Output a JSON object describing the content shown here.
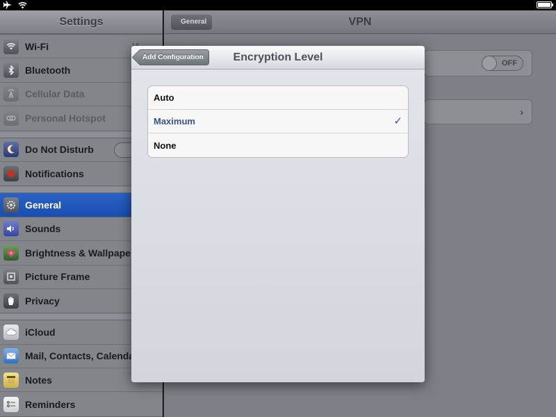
{
  "master": {
    "title": "Settings",
    "groups": [
      [
        {
          "label": "Wi-Fi",
          "icon": "wifi-icon",
          "trail": "Vi"
        },
        {
          "label": "Bluetooth",
          "icon": "bluetooth-icon"
        },
        {
          "label": "Cellular Data",
          "icon": "cellular-icon",
          "disabled": true
        },
        {
          "label": "Personal Hotspot",
          "icon": "hotspot-icon",
          "disabled": true
        }
      ],
      [
        {
          "label": "Do Not Disturb",
          "icon": "moon-icon"
        },
        {
          "label": "Notifications",
          "icon": "notifications-icon"
        }
      ],
      [
        {
          "label": "General",
          "icon": "gear-icon",
          "selected": true
        },
        {
          "label": "Sounds",
          "icon": "speaker-icon"
        },
        {
          "label": "Brightness & Wallpaper",
          "icon": "flower-icon"
        },
        {
          "label": "Picture Frame",
          "icon": "picture-frame-icon"
        },
        {
          "label": "Privacy",
          "icon": "hand-icon"
        }
      ],
      [
        {
          "label": "iCloud",
          "icon": "cloud-icon"
        },
        {
          "label": "Mail, Contacts, Calendars",
          "icon": "mail-icon"
        },
        {
          "label": "Notes",
          "icon": "notes-icon"
        },
        {
          "label": "Reminders",
          "icon": "reminders-icon"
        }
      ]
    ]
  },
  "detail": {
    "title": "VPN",
    "back_label": "General",
    "toggle_label": "OFF"
  },
  "popover": {
    "title": "Encryption Level",
    "back_label": "Add Configuration",
    "options": [
      {
        "label": "Auto",
        "checked": false
      },
      {
        "label": "Maximum",
        "checked": true
      },
      {
        "label": "None",
        "checked": false
      }
    ],
    "check_glyph": "✓"
  },
  "colors": {
    "selection_blue": "#2a62c6",
    "check_blue": "#385487"
  }
}
